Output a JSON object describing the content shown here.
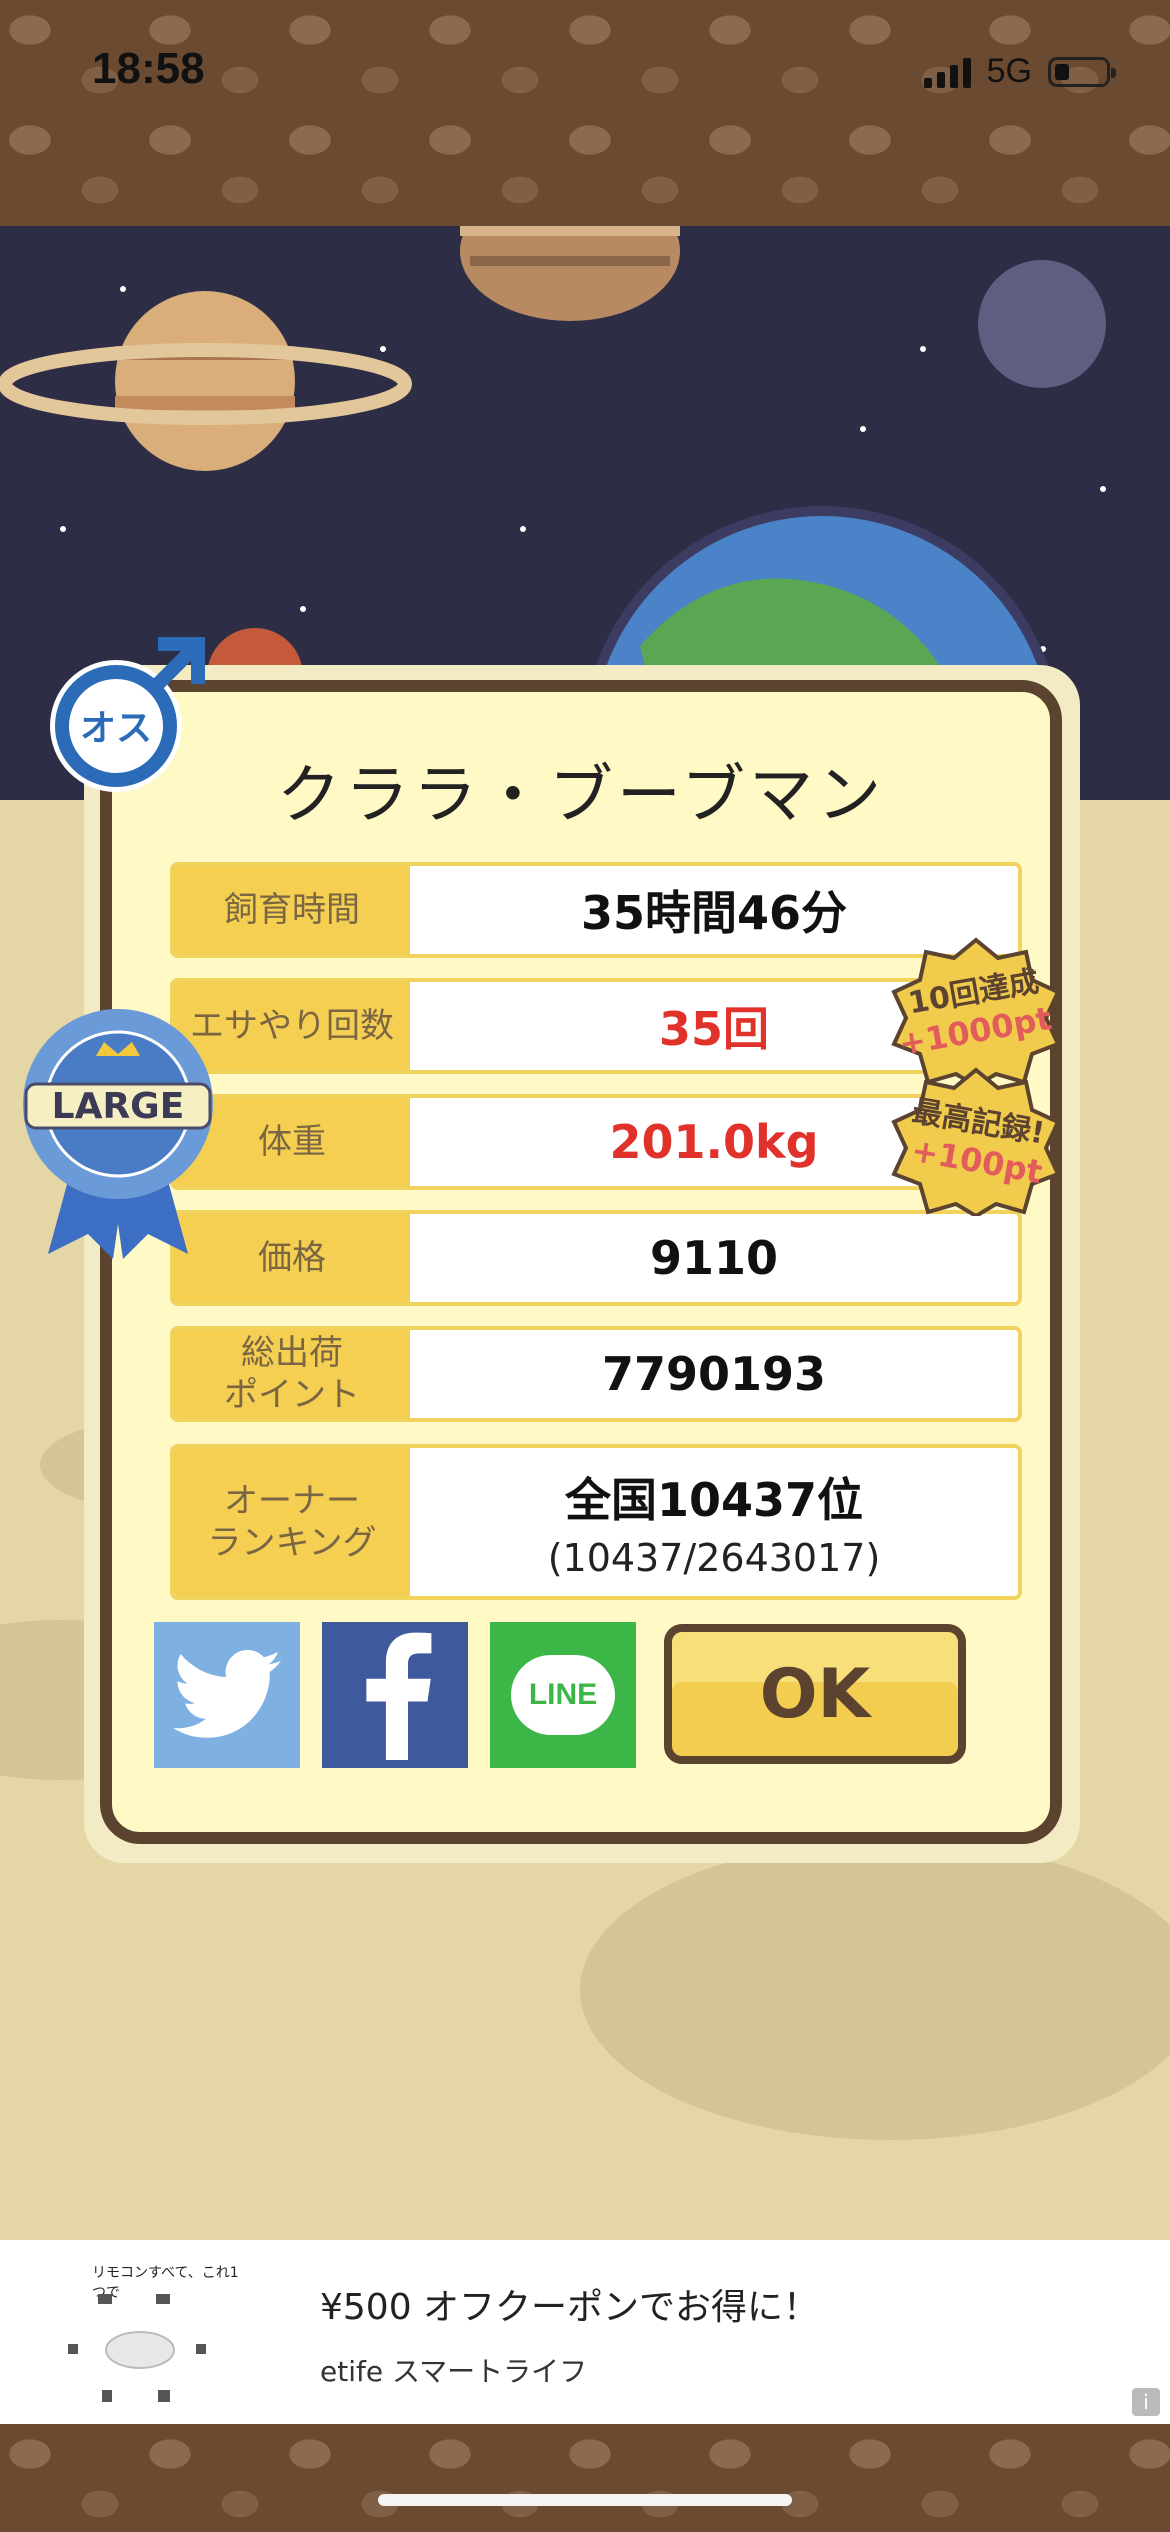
{
  "status_bar": {
    "time": "18:58",
    "network": "5G"
  },
  "gender_badge": {
    "label": "オス"
  },
  "ribbon": {
    "label": "LARGE"
  },
  "character": {
    "name": "クララ・ブーブマン"
  },
  "stats": [
    {
      "label": "飼育時間",
      "value": "35時間46分"
    },
    {
      "label": "エサやり回数",
      "value": "35回"
    },
    {
      "label": "体重",
      "value": "201.0kg"
    },
    {
      "label": "価格",
      "value": "9110"
    },
    {
      "label": "総出荷\nポイント",
      "value": "7790193"
    },
    {
      "label": "オーナー\nランキング",
      "value": "全国10437位",
      "sub": "(10437/2643017)"
    }
  ],
  "bonuses": [
    {
      "line1": "10回達成",
      "line2": "+1000pt"
    },
    {
      "line1": "最高記録!",
      "line2": "+100pt"
    }
  ],
  "share": {
    "line_label": "LINE"
  },
  "ok_button": {
    "label": "OK"
  },
  "ad": {
    "caption": "リモコンすべて、これ1つで",
    "title": "¥500 オフクーポンでお得に！",
    "sponsor": "etife スマートライフ",
    "info": "i"
  },
  "colors": {
    "card_bg": "#fff9c6",
    "card_border": "#5c4330",
    "label_bg": "#f5cf52",
    "highlight_red": "#e0322b",
    "twitter": "#7fb0e2",
    "facebook": "#3f5a9c",
    "line": "#3cb647"
  }
}
